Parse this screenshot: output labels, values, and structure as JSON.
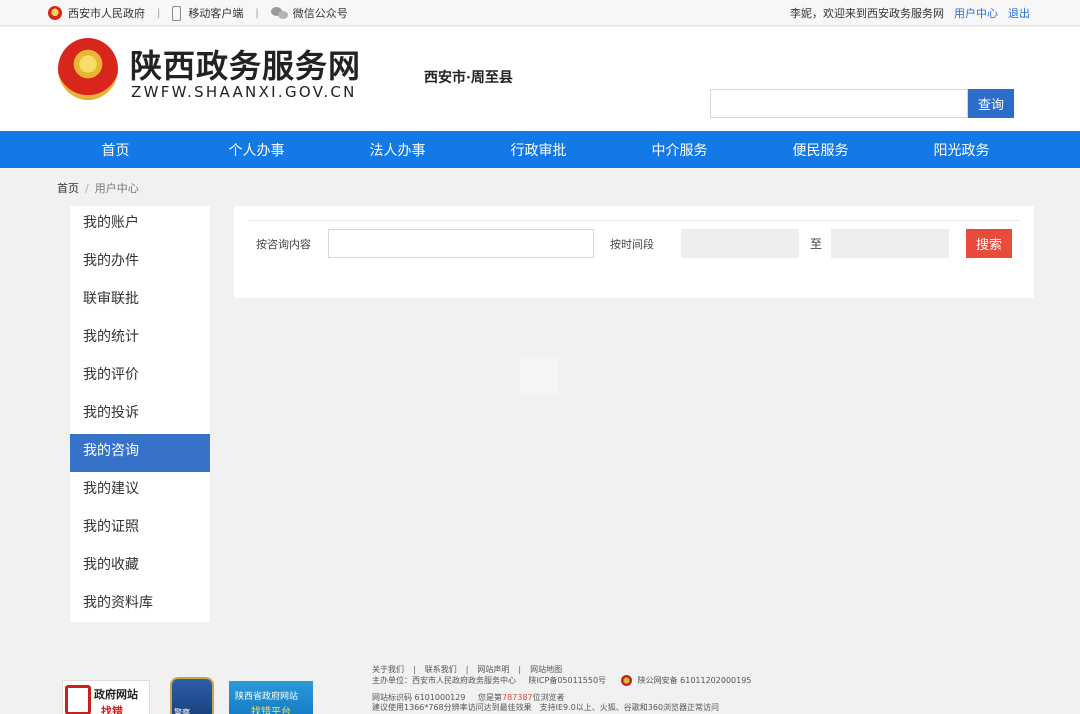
{
  "topbar": {
    "gov_link": "西安市人民政府",
    "mobile_link": "移动客户端",
    "wechat_link": "微信公众号",
    "welcome": "李妮，欢迎来到西安政务服务网",
    "user_center": "用户中心",
    "logout": "退出"
  },
  "header": {
    "logo_cn": "陕西政务服务网",
    "logo_en": "ZWFW.SHAANXI.GOV.CN",
    "region": "西安市·周至县",
    "search_placeholder": "",
    "search_button": "查询"
  },
  "nav": [
    "首页",
    "个人办事",
    "法人办事",
    "行政审批",
    "中介服务",
    "便民服务",
    "阳光政务"
  ],
  "breadcrumb": {
    "home": "首页",
    "separator": "/",
    "current": "用户中心"
  },
  "sidebar": {
    "items": [
      "我的账户",
      "我的办件",
      "联审联批",
      "我的统计",
      "我的评价",
      "我的投诉",
      "我的咨询",
      "我的建议",
      "我的证照",
      "我的收藏",
      "我的资料库"
    ],
    "active_index": 6
  },
  "filter": {
    "content_label": "按咨询内容",
    "content_value": "",
    "time_label": "按时间段",
    "date_from": "",
    "to_label": "至",
    "date_to": "",
    "search_button": "搜索"
  },
  "footer": {
    "links": [
      "关于我们",
      "联系我们",
      "网站声明",
      "网站地图"
    ],
    "link_separator": "|",
    "sponsor": "主办单位：西安市人民政府政务服务中心",
    "icp": "陕ICP备05011550号",
    "police": "陕公网安备 61011202000195",
    "site_code": "网站标识码 6101000129",
    "visitor_prefix": "您是第",
    "visitor_count": "787387",
    "visitor_suffix": "位浏览者",
    "browser_note": "建议使用1366*768分辨率访问达到最佳效果　支持IE9.0以上、火狐、谷歌和360浏览器正常访问",
    "badge_gov_1": "政府网站",
    "badge_gov_2": "找错",
    "badge_police": "警察",
    "badge_report_1": "陕西省政府网站",
    "badge_report_2": "找错平台"
  },
  "colors": {
    "nav_bg": "#1279e6",
    "sidebar_active": "#3772c9",
    "search_btn": "#2d6cc8",
    "red_btn": "#e84a3b"
  }
}
